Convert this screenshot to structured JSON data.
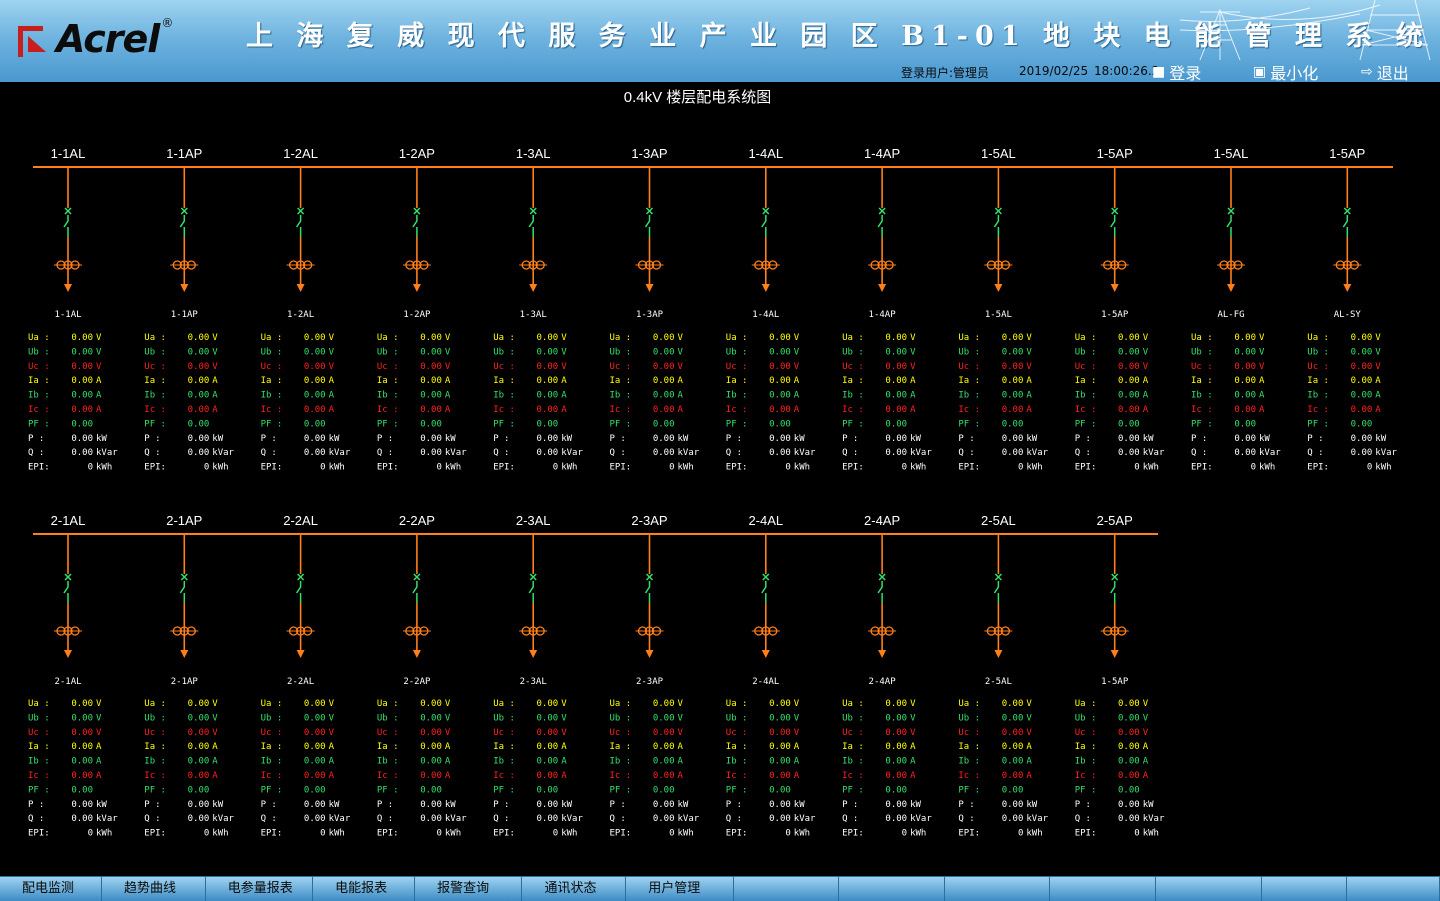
{
  "header": {
    "logo_text": "Acrel",
    "logo_mark": "®",
    "title": "上 海 复 威 现 代 服 务 业 产 业 园 区 B1-01 地 块 电 能 管 理 系 统",
    "login_user": "登录用户:管理员",
    "date": "2019/02/25",
    "time": "18:00:26.2",
    "login_label": "登录",
    "minimize_label": "最小化",
    "exit_label": "退出",
    "login_icon": "user-icon",
    "minimize_icon": "minimize-icon",
    "exit_icon": "exit-icon"
  },
  "page_title": "0.4kV 楼层配电系统图",
  "colors": {
    "bus": "#ff7f1a",
    "breaker": "#33e06a",
    "ua": "#ffff00",
    "ub": "#33e06a",
    "uc": "#ff2020",
    "white": "#ffffff"
  },
  "field_labels": [
    "Ua :",
    "Ub :",
    "Uc :",
    "Ia :",
    "Ib :",
    "Ic :",
    "PF :",
    "P  :",
    "Q  :",
    "EPI:"
  ],
  "field_units": [
    "V",
    "V",
    "V",
    "A",
    "A",
    "A",
    "",
    "kW",
    "kVar",
    "kWh"
  ],
  "rows": [
    {
      "name": "row1",
      "feeders": [
        {
          "top": "1-1AL",
          "bottom": "1-1AL",
          "values": [
            "0.00",
            "0.00",
            "0.00",
            "0.00",
            "0.00",
            "0.00",
            "0.00",
            "0.00",
            "0.00",
            "0"
          ]
        },
        {
          "top": "1-1AP",
          "bottom": "1-1AP",
          "values": [
            "0.00",
            "0.00",
            "0.00",
            "0.00",
            "0.00",
            "0.00",
            "0.00",
            "0.00",
            "0.00",
            "0"
          ]
        },
        {
          "top": "1-2AL",
          "bottom": "1-2AL",
          "values": [
            "0.00",
            "0.00",
            "0.00",
            "0.00",
            "0.00",
            "0.00",
            "0.00",
            "0.00",
            "0.00",
            "0"
          ]
        },
        {
          "top": "1-2AP",
          "bottom": "1-2AP",
          "values": [
            "0.00",
            "0.00",
            "0.00",
            "0.00",
            "0.00",
            "0.00",
            "0.00",
            "0.00",
            "0.00",
            "0"
          ]
        },
        {
          "top": "1-3AL",
          "bottom": "1-3AL",
          "values": [
            "0.00",
            "0.00",
            "0.00",
            "0.00",
            "0.00",
            "0.00",
            "0.00",
            "0.00",
            "0.00",
            "0"
          ]
        },
        {
          "top": "1-3AP",
          "bottom": "1-3AP",
          "values": [
            "0.00",
            "0.00",
            "0.00",
            "0.00",
            "0.00",
            "0.00",
            "0.00",
            "0.00",
            "0.00",
            "0"
          ]
        },
        {
          "top": "1-4AL",
          "bottom": "1-4AL",
          "values": [
            "0.00",
            "0.00",
            "0.00",
            "0.00",
            "0.00",
            "0.00",
            "0.00",
            "0.00",
            "0.00",
            "0"
          ]
        },
        {
          "top": "1-4AP",
          "bottom": "1-4AP",
          "values": [
            "0.00",
            "0.00",
            "0.00",
            "0.00",
            "0.00",
            "0.00",
            "0.00",
            "0.00",
            "0.00",
            "0"
          ]
        },
        {
          "top": "1-5AL",
          "bottom": "1-5AL",
          "values": [
            "0.00",
            "0.00",
            "0.00",
            "0.00",
            "0.00",
            "0.00",
            "0.00",
            "0.00",
            "0.00",
            "0"
          ]
        },
        {
          "top": "1-5AP",
          "bottom": "1-5AP",
          "values": [
            "0.00",
            "0.00",
            "0.00",
            "0.00",
            "0.00",
            "0.00",
            "0.00",
            "0.00",
            "0.00",
            "0"
          ]
        },
        {
          "top": "1-5AL",
          "bottom": "AL-FG",
          "values": [
            "0.00",
            "0.00",
            "0.00",
            "0.00",
            "0.00",
            "0.00",
            "0.00",
            "0.00",
            "0.00",
            "0"
          ]
        },
        {
          "top": "1-5AP",
          "bottom": "AL-SY",
          "values": [
            "0.00",
            "0.00",
            "0.00",
            "0.00",
            "0.00",
            "0.00",
            "0.00",
            "0.00",
            "0.00",
            "0"
          ]
        }
      ]
    },
    {
      "name": "row2",
      "feeders": [
        {
          "top": "2-1AL",
          "bottom": "2-1AL",
          "values": [
            "0.00",
            "0.00",
            "0.00",
            "0.00",
            "0.00",
            "0.00",
            "0.00",
            "0.00",
            "0.00",
            "0"
          ]
        },
        {
          "top": "2-1AP",
          "bottom": "2-1AP",
          "values": [
            "0.00",
            "0.00",
            "0.00",
            "0.00",
            "0.00",
            "0.00",
            "0.00",
            "0.00",
            "0.00",
            "0"
          ]
        },
        {
          "top": "2-2AL",
          "bottom": "2-2AL",
          "values": [
            "0.00",
            "0.00",
            "0.00",
            "0.00",
            "0.00",
            "0.00",
            "0.00",
            "0.00",
            "0.00",
            "0"
          ]
        },
        {
          "top": "2-2AP",
          "bottom": "2-2AP",
          "values": [
            "0.00",
            "0.00",
            "0.00",
            "0.00",
            "0.00",
            "0.00",
            "0.00",
            "0.00",
            "0.00",
            "0"
          ]
        },
        {
          "top": "2-3AL",
          "bottom": "2-3AL",
          "values": [
            "0.00",
            "0.00",
            "0.00",
            "0.00",
            "0.00",
            "0.00",
            "0.00",
            "0.00",
            "0.00",
            "0"
          ]
        },
        {
          "top": "2-3AP",
          "bottom": "2-3AP",
          "values": [
            "0.00",
            "0.00",
            "0.00",
            "0.00",
            "0.00",
            "0.00",
            "0.00",
            "0.00",
            "0.00",
            "0"
          ]
        },
        {
          "top": "2-4AL",
          "bottom": "2-4AL",
          "values": [
            "0.00",
            "0.00",
            "0.00",
            "0.00",
            "0.00",
            "0.00",
            "0.00",
            "0.00",
            "0.00",
            "0"
          ]
        },
        {
          "top": "2-4AP",
          "bottom": "2-4AP",
          "values": [
            "0.00",
            "0.00",
            "0.00",
            "0.00",
            "0.00",
            "0.00",
            "0.00",
            "0.00",
            "0.00",
            "0"
          ]
        },
        {
          "top": "2-5AL",
          "bottom": "2-5AL",
          "values": [
            "0.00",
            "0.00",
            "0.00",
            "0.00",
            "0.00",
            "0.00",
            "0.00",
            "0.00",
            "0.00",
            "0"
          ]
        },
        {
          "top": "2-5AP",
          "bottom": "1-5AP",
          "values": [
            "0.00",
            "0.00",
            "0.00",
            "0.00",
            "0.00",
            "0.00",
            "0.00",
            "0.00",
            "0.00",
            "0"
          ]
        }
      ]
    }
  ],
  "footer": {
    "tabs": [
      "配电监测",
      "趋势曲线",
      "电参量报表",
      "电能报表",
      "报警查询",
      "通讯状态",
      "用户管理",
      "",
      "",
      "",
      "",
      "",
      "",
      ""
    ]
  }
}
